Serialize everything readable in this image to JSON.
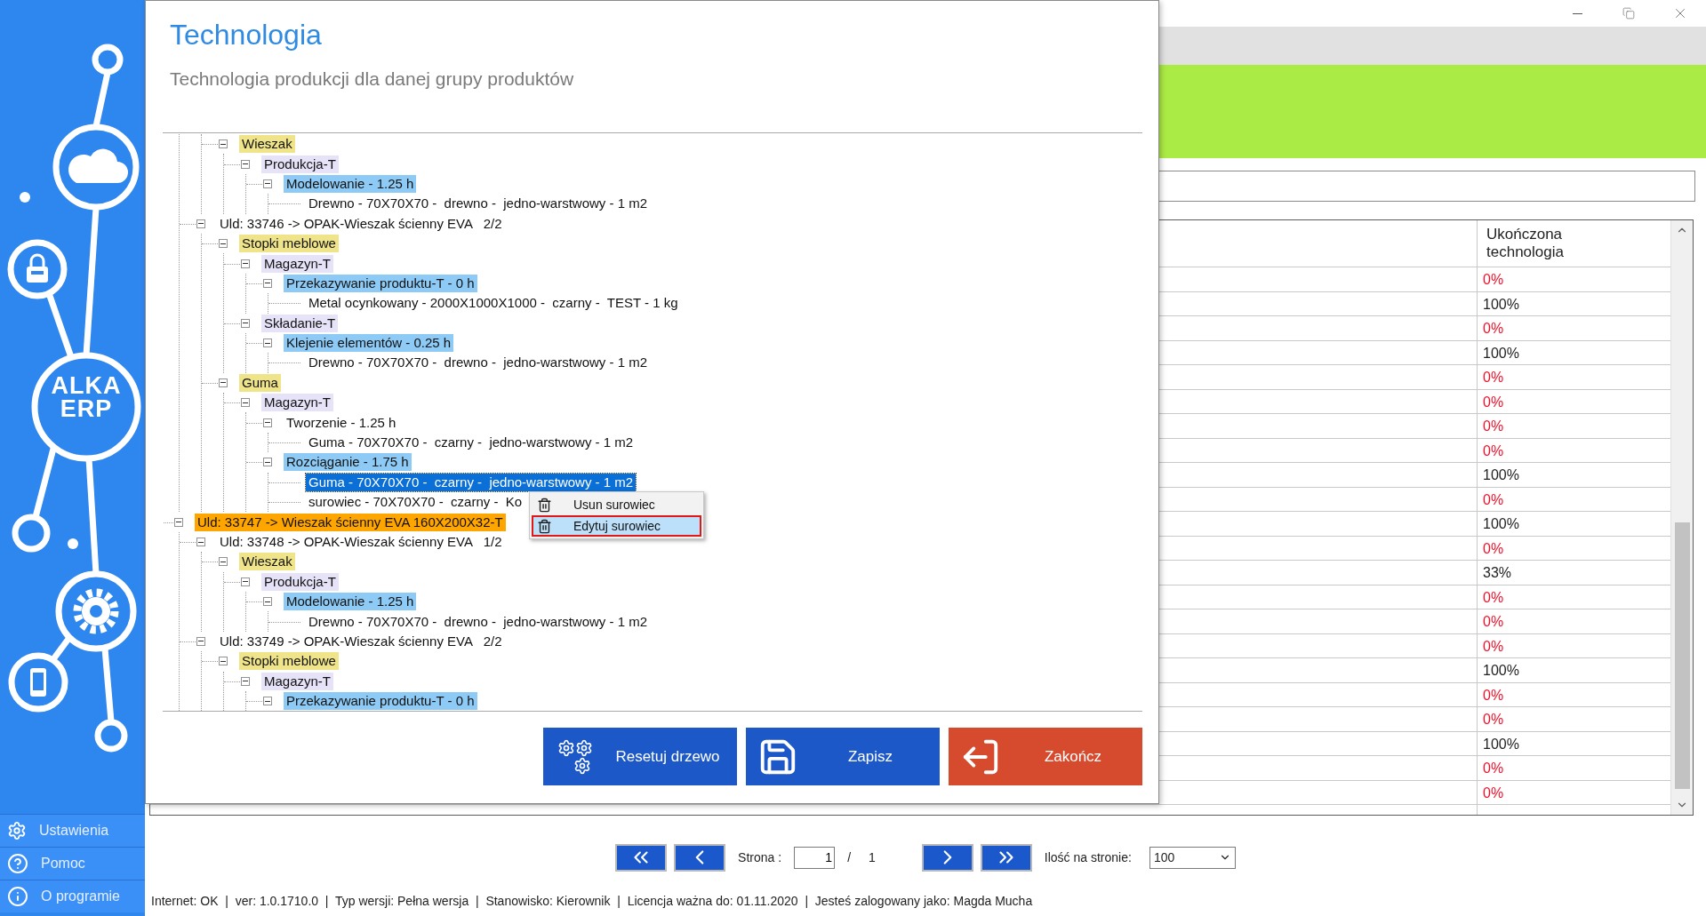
{
  "sidebar": {
    "logo": "ALKA ERP",
    "menu": [
      {
        "label": "Ustawienia",
        "kind": "settings"
      },
      {
        "label": "Pomoc",
        "kind": "help"
      },
      {
        "label": "O programie",
        "kind": "about"
      }
    ]
  },
  "dialog": {
    "title": "Technologia",
    "subtitle": "Technologia produkcji dla danej grupy produktów",
    "tree": [
      {
        "children": [
          {
            "children": [
              {
                "label": "Wieszak",
                "kind": "product",
                "selected": false,
                "expanded": true,
                "children": [
                  {
                    "label": "Produkcja-T",
                    "kind": "workstation",
                    "selected": false,
                    "expanded": true,
                    "children": [
                      {
                        "label": "Modelowanie - 1.25 h",
                        "kind": "operation",
                        "selected": false,
                        "expanded": true,
                        "children": [
                          {
                            "label": "Drewno - 70X70X70 -  drewno -  jedno-warstwowy - 1 m2",
                            "selected": false
                          }
                        ]
                      }
                    ]
                  }
                ]
              }
            ]
          },
          {
            "label": "Uld: 33746 -> OPAK-Wieszak ścienny EVA   2/2",
            "selected": false,
            "expanded": true,
            "children": [
              {
                "label": "Stopki meblowe",
                "kind": "product",
                "selected": false,
                "expanded": true,
                "children": [
                  {
                    "label": "Magazyn-T",
                    "kind": "workstation",
                    "selected": false,
                    "expanded": true,
                    "children": [
                      {
                        "label": "Przekazywanie produktu-T - 0 h",
                        "kind": "operation",
                        "selected": false,
                        "expanded": true,
                        "children": [
                          {
                            "label": "Metal ocynkowany - 2000X1000X1000 -  czarny -  TEST - 1 kg",
                            "selected": false
                          }
                        ]
                      }
                    ]
                  },
                  {
                    "label": "Składanie-T",
                    "kind": "workstation",
                    "selected": false,
                    "expanded": true,
                    "children": [
                      {
                        "label": "Klejenie elementów - 0.25 h",
                        "kind": "operation",
                        "selected": false,
                        "expanded": true,
                        "children": [
                          {
                            "label": "Drewno - 70X70X70 -  drewno -  jedno-warstwowy - 1 m2",
                            "selected": false
                          }
                        ]
                      }
                    ]
                  }
                ]
              },
              {
                "label": "Guma",
                "kind": "product",
                "selected": false,
                "expanded": true,
                "children": [
                  {
                    "label": "Magazyn-T",
                    "kind": "workstation",
                    "selected": false,
                    "expanded": true,
                    "children": [
                      {
                        "label": "Tworzenie - 1.25 h",
                        "selected": false,
                        "expanded": true,
                        "children": [
                          {
                            "label": "Guma - 70X70X70 -  czarny -  jedno-warstwowy - 1 m2",
                            "selected": false
                          }
                        ]
                      },
                      {
                        "label": "Rozciąganie - 1.75 h",
                        "kind": "operation",
                        "selected": false,
                        "expanded": true,
                        "children": [
                          {
                            "label": "Guma - 70X70X70 -  czarny -  jedno-warstwowy - 1 m2",
                            "selected": true
                          },
                          {
                            "label": "surowiec - 70X70X70 -  czarny -  Ko",
                            "selected": false
                          }
                        ]
                      }
                    ]
                  }
                ]
              }
            ]
          }
        ]
      },
      {
        "label": "Uld: 33747 -> Wieszak ścienny EVA 160X200X32-T",
        "kind": "order",
        "selected": false,
        "expanded": true,
        "children": [
          {
            "label": "Uld: 33748 -> OPAK-Wieszak ścienny EVA   1/2",
            "selected": false,
            "expanded": true,
            "children": [
              {
                "label": "Wieszak",
                "kind": "product",
                "selected": false,
                "expanded": true,
                "children": [
                  {
                    "label": "Produkcja-T",
                    "kind": "workstation",
                    "selected": false,
                    "expanded": true,
                    "children": [
                      {
                        "label": "Modelowanie - 1.25 h",
                        "kind": "operation",
                        "selected": false,
                        "expanded": true,
                        "children": [
                          {
                            "label": "Drewno - 70X70X70 -  drewno -  jedno-warstwowy - 1 m2",
                            "selected": false
                          }
                        ]
                      }
                    ]
                  }
                ]
              }
            ]
          },
          {
            "label": "Uld: 33749 -> OPAK-Wieszak ścienny EVA   2/2",
            "selected": false,
            "expanded": true,
            "children": [
              {
                "label": "Stopki meblowe",
                "kind": "product",
                "selected": false,
                "expanded": true,
                "children": [
                  {
                    "label": "Magazyn-T",
                    "kind": "workstation",
                    "selected": false,
                    "expanded": true,
                    "children": [
                      {
                        "label": "Przekazywanie produktu-T - 0 h",
                        "kind": "operation",
                        "selected": false,
                        "expanded": true
                      }
                    ]
                  }
                ]
              }
            ]
          }
        ]
      }
    ],
    "context_menu": [
      {
        "label": "Usun surowiec",
        "selected": false
      },
      {
        "label": "Edytuj surowiec",
        "selected": true
      }
    ],
    "buttons": [
      {
        "label": "Resetuj drzewo",
        "kind": "reset"
      },
      {
        "label": "Zapisz",
        "kind": "save"
      },
      {
        "label": "Zakończ",
        "kind": "exit"
      }
    ]
  },
  "table": {
    "columns": [
      {
        "label": "Ukończona technologia"
      }
    ],
    "rows": [
      {
        "completion": "0%",
        "alert": true
      },
      {
        "completion": "100%",
        "alert": false
      },
      {
        "completion": "0%",
        "alert": true
      },
      {
        "completion": "100%",
        "alert": false
      },
      {
        "completion": "0%",
        "alert": true
      },
      {
        "completion": "0%",
        "alert": true
      },
      {
        "completion": "0%",
        "alert": true
      },
      {
        "completion": "0%",
        "alert": true
      },
      {
        "completion": "100%",
        "alert": false
      },
      {
        "completion": "0%",
        "alert": true
      },
      {
        "completion": "100%",
        "alert": false
      },
      {
        "completion": "0%",
        "alert": true
      },
      {
        "completion": "33%",
        "alert": false
      },
      {
        "completion": "0%",
        "alert": true
      },
      {
        "completion": "0%",
        "alert": true
      },
      {
        "completion": "0%",
        "alert": true
      },
      {
        "completion": "100%",
        "alert": false
      },
      {
        "completion": "0%",
        "alert": true
      },
      {
        "completion": "0%",
        "alert": true
      },
      {
        "completion": "100%",
        "alert": false
      },
      {
        "completion": "0%",
        "alert": true
      },
      {
        "completion": "0%",
        "alert": true
      }
    ]
  },
  "pagination": {
    "page_label": "Strona :",
    "page": "1",
    "separator": "/",
    "total": "1",
    "per_page_label": "Ilość na stronie:",
    "per_page": "100"
  },
  "status_bar": "Internet: OK  |  ver: 1.0.1710.0  |  Typ wersji: Pełna wersja  |  Stanowisko: Kierownik  |  Licencja ważna do: 01.11.2020  |  Jesteś zalogowany jako: Magda Mucha"
}
